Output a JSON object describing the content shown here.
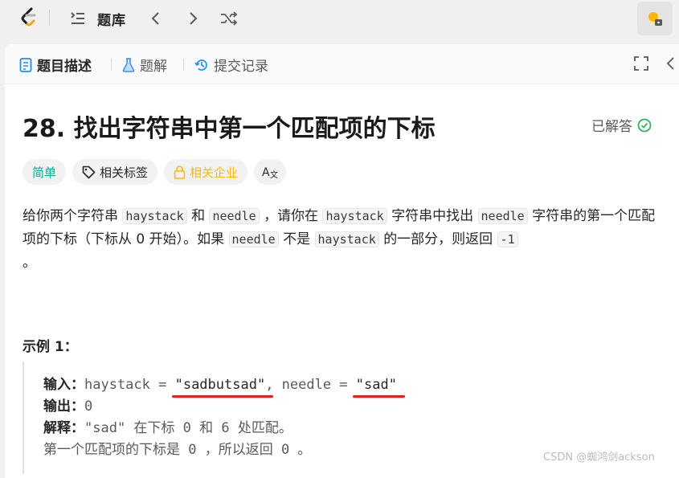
{
  "topbar": {
    "title": "题库",
    "icons": [
      "leetcode-logo",
      "list-icon",
      "prev-icon",
      "next-icon",
      "shuffle-icon",
      "avatar-icon"
    ]
  },
  "tabs": [
    {
      "label": "题目描述",
      "icon": "description-icon",
      "active": true
    },
    {
      "label": "题解",
      "icon": "flask-icon",
      "active": false
    },
    {
      "label": "提交记录",
      "icon": "history-icon",
      "active": false
    }
  ],
  "problem": {
    "title": "28. 找出字符串中第一个匹配项的下标",
    "status": "已解答",
    "badges": {
      "difficulty": "简单",
      "tags": "相关标签",
      "companies": "相关企业",
      "translate": "A文"
    },
    "desc": {
      "p1": "给你两个字符串",
      "c1": "haystack",
      "p2": "和",
      "c2": "needle",
      "p3": "，请你在",
      "c3": "haystack",
      "p4": "字符串中找出",
      "c4": "needle",
      "p5": "字符串的第一个匹配项的下标（下标从 0 开始）。如果",
      "c5": "needle",
      "p6": "不是",
      "c6": "haystack",
      "p7": "的一部分，则返回",
      "c7": "-1",
      "p8": "。"
    },
    "example": {
      "title": "示例 1：",
      "input_label": "输入：",
      "input_a": "haystack = ",
      "input_hay": "\"sadbutsad\"",
      "input_b": ", needle = ",
      "input_needle": "\"sad\"",
      "output_label": "输出：",
      "output_value": "0",
      "explain_label": "解释：",
      "explain_value": "\"sad\" 在下标 0 和 6 处匹配。",
      "line4": "第一个匹配项的下标是 0 ，所以返回 0 。"
    }
  },
  "watermark": "CSDN @蜘鸿剑ackson",
  "colors": {
    "easy": "#00af9b",
    "company": "#ffb800",
    "solved": "#2db55d",
    "underline": "#e02020"
  }
}
